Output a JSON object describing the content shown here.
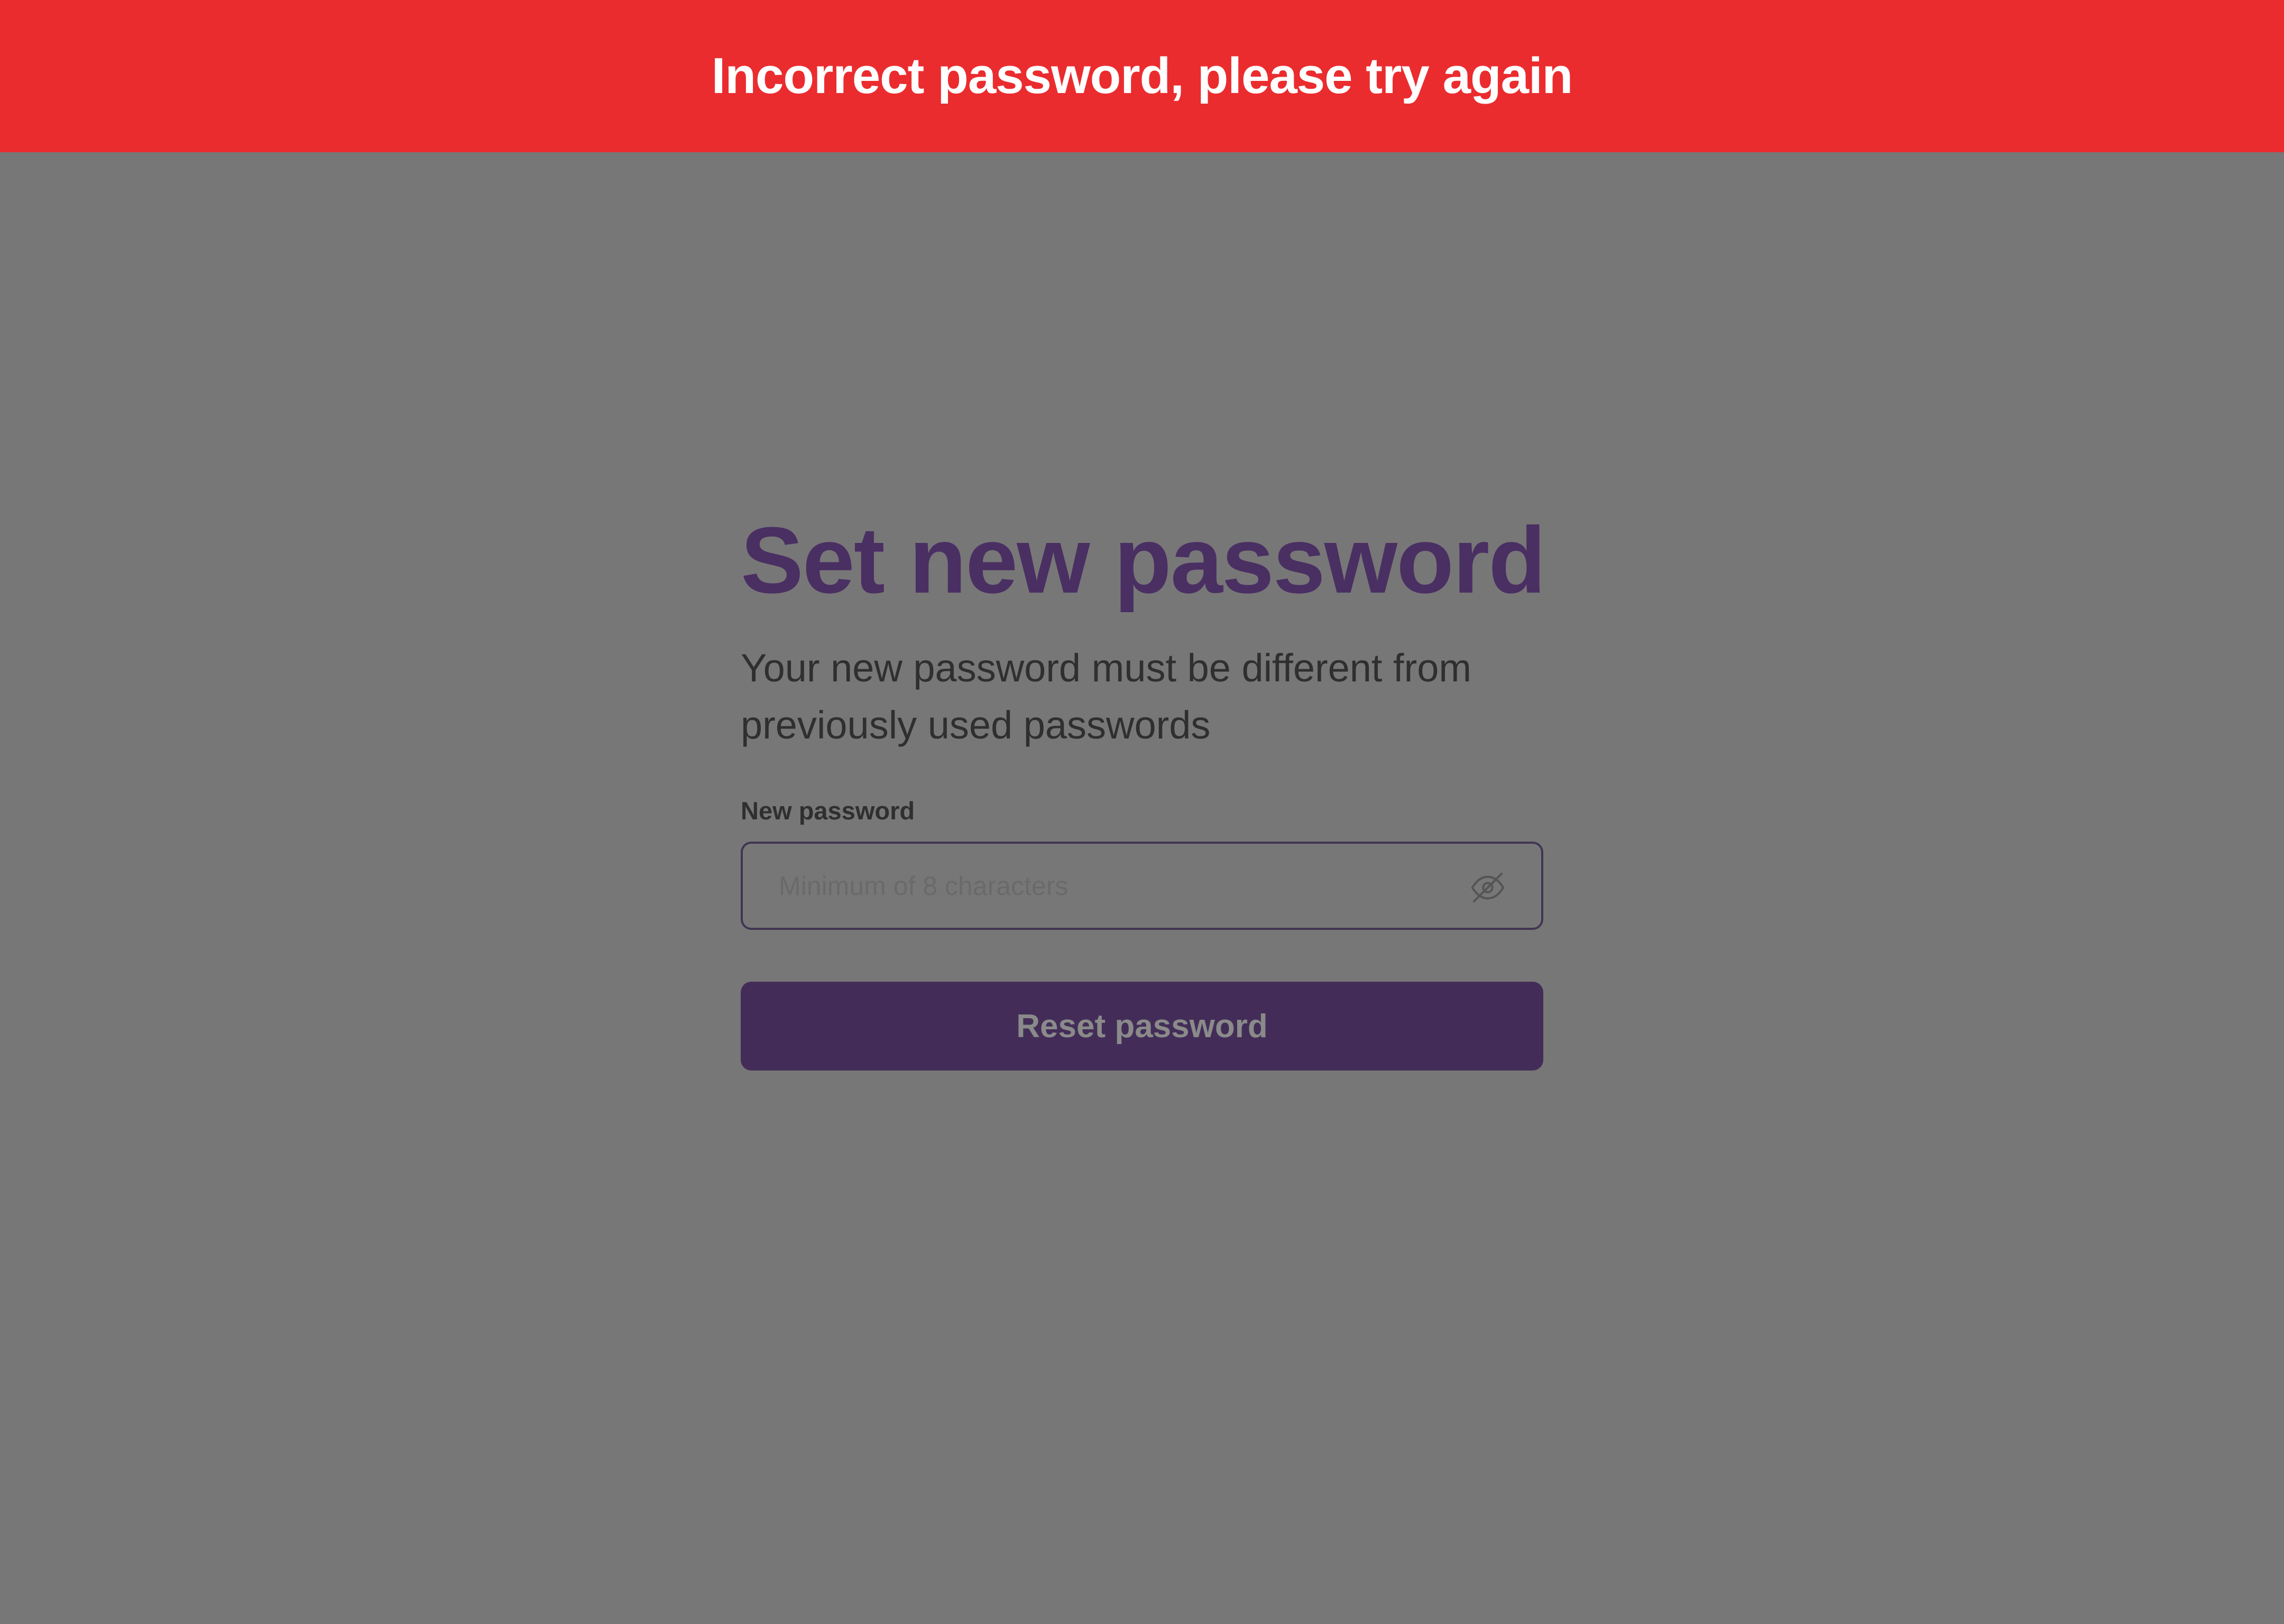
{
  "banner": {
    "message": "Incorrect password, please try again",
    "color": "#eb2c2f"
  },
  "page": {
    "title": "Set new password",
    "subtitle": "Your new password must be different from previously used passwords",
    "background": "#777777",
    "accent": "#4a2f63"
  },
  "form": {
    "password_label": "New password",
    "password_placeholder": "Minimum of 8 characters",
    "password_value": "",
    "visibility_icon": "eye-off-icon",
    "submit_label": "Reset password"
  }
}
